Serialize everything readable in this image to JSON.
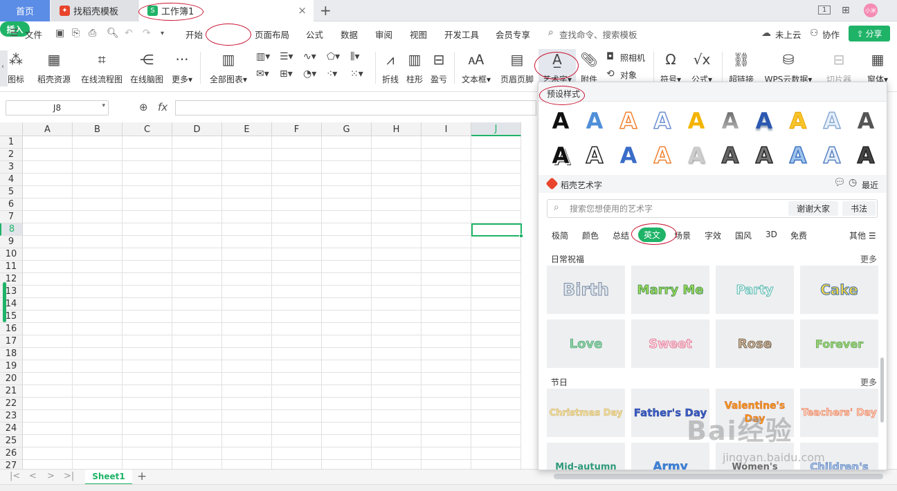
{
  "tabs": {
    "home": "首页",
    "docer": "找稻壳模板",
    "workbook": "工作簿1",
    "close": "×",
    "add": "+"
  },
  "window": {
    "layout_icon": "1",
    "avatar": "小米"
  },
  "menu": {
    "file": "文件",
    "items": [
      "开始",
      "插入",
      "页面布局",
      "公式",
      "数据",
      "审阅",
      "视图",
      "开发工具",
      "会员专享"
    ],
    "search": "查找命令、搜索模板",
    "cloud": "未上云",
    "collab": "协作",
    "share": "分享"
  },
  "ribbon": {
    "items": [
      "图标",
      "稻壳资源",
      "在线流程图",
      "在线脑图",
      "更多",
      "全部图表",
      "折线",
      "柱形",
      "盈亏",
      "文本框",
      "页眉页脚",
      "艺术字",
      "附件",
      "照相机",
      "对象",
      "符号",
      "公式",
      "超链接",
      "WPS云数据",
      "切片器",
      "窗体"
    ]
  },
  "formula": {
    "cell_ref": "J8",
    "fx": "fx",
    "value": ""
  },
  "grid": {
    "columns": [
      "A",
      "B",
      "C",
      "D",
      "E",
      "F",
      "G",
      "H",
      "I",
      "J"
    ],
    "rows": [
      "1",
      "2",
      "3",
      "4",
      "5",
      "6",
      "7",
      "8",
      "9",
      "10",
      "11",
      "12",
      "13",
      "14",
      "15",
      "16",
      "17",
      "18",
      "19",
      "20",
      "21",
      "22",
      "23",
      "24",
      "25",
      "26",
      "27"
    ],
    "selected_col": "J",
    "selected_row": "8"
  },
  "sheets": {
    "active": "Sheet1",
    "add": "+"
  },
  "panel": {
    "preset_title": "预设样式",
    "preset_glyph": "A",
    "docer_title": "稻壳艺术字",
    "recent": "最近",
    "search_placeholder": "搜索您想使用的艺术字",
    "tags": [
      "谢谢大家",
      "书法"
    ],
    "categories": [
      "极简",
      "颜色",
      "总结",
      "英文",
      "场景",
      "字效",
      "国风",
      "3D",
      "免费"
    ],
    "active_category": "英文",
    "more_cats": "其他",
    "sections": [
      {
        "title": "日常祝福",
        "more": "更多",
        "cards": [
          "Birth",
          "Marry Me",
          "Party",
          "Cake",
          "Love",
          "Sweet",
          "Rose",
          "Forever"
        ]
      },
      {
        "title": "节日",
        "more": "更多",
        "cards": [
          "Christmas Day",
          "Father's Day",
          "Valentine's Day",
          "Teachers' Day",
          "Mid-autumn",
          "Army",
          "Women's",
          "Children's"
        ]
      }
    ]
  },
  "watermark": {
    "brand": "Bai经验",
    "url": "jingyan.baidu.com"
  },
  "colors": {
    "accent": "#1fb368",
    "home_tab": "#5b8ce6",
    "annotation": "#c8102e"
  }
}
